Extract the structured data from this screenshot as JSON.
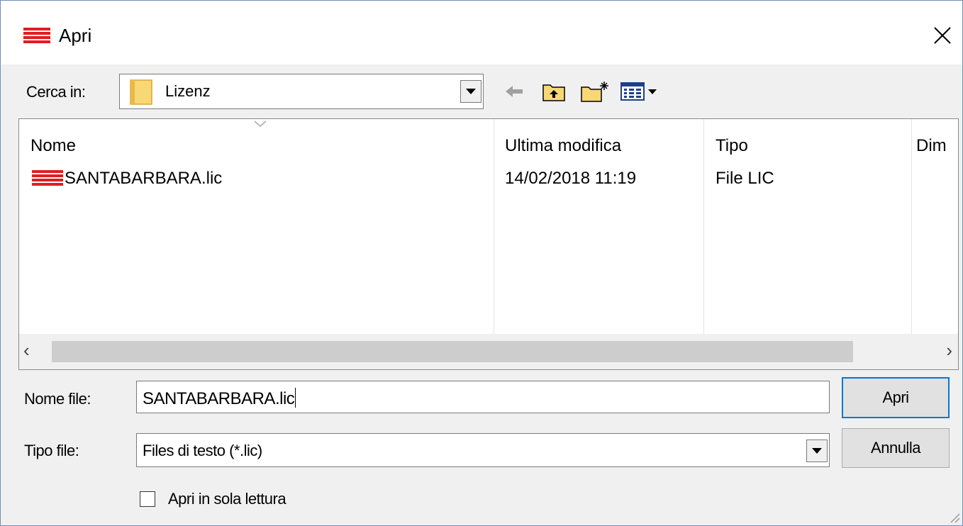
{
  "window": {
    "title": "Apri",
    "icons": {
      "app": "red-stripes-icon",
      "close": "close-icon"
    }
  },
  "lookin": {
    "label": "Cerca in:",
    "value": "Lizenz",
    "icon": "folder-icon"
  },
  "toolbar": {
    "icons": [
      "back-arrow-icon",
      "up-folder-icon",
      "new-folder-icon",
      "view-menu-icon"
    ]
  },
  "filelist": {
    "columns": [
      "Nome",
      "Ultima modifica",
      "Tipo",
      "Dim"
    ],
    "rows": [
      {
        "name": "SANTABARBARA.lic",
        "modified": "14/02/2018 11:19",
        "type": "File LIC",
        "icon": "red-stripes-icon"
      }
    ]
  },
  "form": {
    "filename_label": "Nome file:",
    "filename_value": "SANTABARBARA.lic",
    "filetype_label": "Tipo file:",
    "filetype_value": "Files di testo (*.lic)",
    "readonly_label": "Apri in sola lettura",
    "readonly_checked": false
  },
  "buttons": {
    "open": "Apri",
    "cancel": "Annulla"
  },
  "colors": {
    "accent": "#0078d7",
    "brand_red": "#e31b23",
    "folder_yellow": "#f8d775"
  }
}
